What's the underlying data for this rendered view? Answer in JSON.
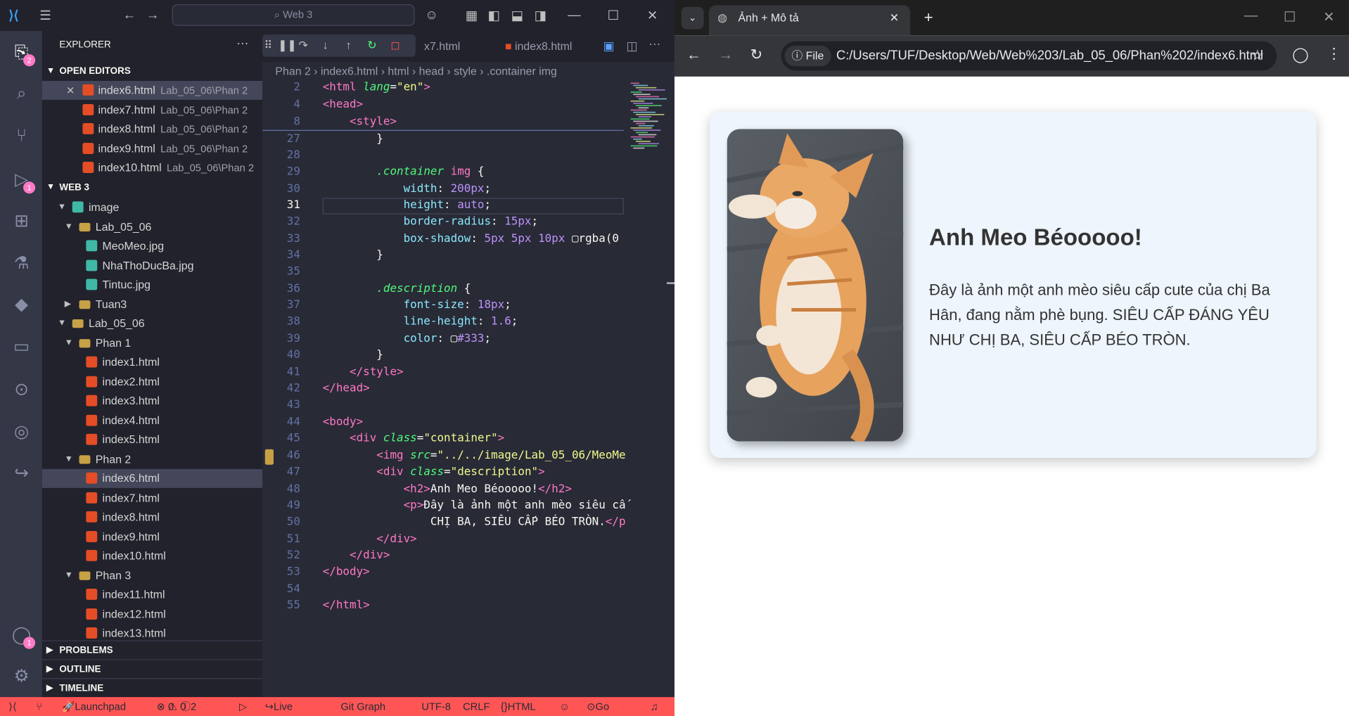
{
  "vscode": {
    "search": "Web 3",
    "sidebar_title": "EXPLORER",
    "open_editors_label": "OPEN EDITORS",
    "open_editors": [
      {
        "name": "index6.html",
        "path": "Lab_05_06\\Phan 2"
      },
      {
        "name": "index7.html",
        "path": "Lab_05_06\\Phan 2"
      },
      {
        "name": "index8.html",
        "path": "Lab_05_06\\Phan 2"
      },
      {
        "name": "index9.html",
        "path": "Lab_05_06\\Phan 2"
      },
      {
        "name": "index10.html",
        "path": "Lab_05_06\\Phan 2"
      }
    ],
    "workspace_label": "WEB 3",
    "tree": [
      {
        "label": "image",
        "kind": "folder-img"
      },
      {
        "label": "Lab_05_06",
        "kind": "folder"
      },
      {
        "label": "MeoMeo.jpg",
        "kind": "img"
      },
      {
        "label": "NhaThoDucBa.jpg",
        "kind": "img"
      },
      {
        "label": "Tintuc.jpg",
        "kind": "img"
      },
      {
        "label": "Tuan3",
        "kind": "folder"
      },
      {
        "label": "Lab_05_06",
        "kind": "folder"
      },
      {
        "label": "Phan 1",
        "kind": "folder"
      },
      {
        "label": "index1.html",
        "kind": "html"
      },
      {
        "label": "index2.html",
        "kind": "html"
      },
      {
        "label": "index3.html",
        "kind": "html"
      },
      {
        "label": "index4.html",
        "kind": "html"
      },
      {
        "label": "index5.html",
        "kind": "html"
      },
      {
        "label": "Phan 2",
        "kind": "folder"
      },
      {
        "label": "index6.html",
        "kind": "html"
      },
      {
        "label": "index7.html",
        "kind": "html"
      },
      {
        "label": "index8.html",
        "kind": "html"
      },
      {
        "label": "index9.html",
        "kind": "html"
      },
      {
        "label": "index10.html",
        "kind": "html"
      },
      {
        "label": "Phan 3",
        "kind": "folder"
      },
      {
        "label": "index11.html",
        "kind": "html"
      },
      {
        "label": "index12.html",
        "kind": "html"
      },
      {
        "label": "index13.html",
        "kind": "html"
      }
    ],
    "panels": [
      "PROBLEMS",
      "OUTLINE",
      "TIMELINE"
    ],
    "tabs": [
      "x7.html",
      "index8.html"
    ],
    "breadcrumb": [
      "Phan 2",
      "index6.html",
      "html",
      "head",
      "style",
      ".container img"
    ],
    "line_numbers": [
      "2",
      "4",
      "8",
      "27",
      "28",
      "29",
      "30",
      "31",
      "32",
      "33",
      "34",
      "35",
      "36",
      "37",
      "38",
      "39",
      "40",
      "41",
      "42",
      "43",
      "44",
      "45",
      "46",
      "47",
      "48",
      "49",
      "50",
      "51",
      "52",
      "53",
      "54",
      "55"
    ],
    "status": {
      "launchpad": "Launchpad",
      "errors": "0",
      "warnings": "0",
      "info": "2",
      "live_share": "Live Share",
      "git_graph": "Git Graph",
      "encoding": "UTF-8",
      "eol": "CRLF",
      "language": "HTML",
      "go_live": "Go Live"
    },
    "accent_color": "#ff5555"
  },
  "browser": {
    "tab_title": "Ảnh + Mô tả",
    "site_chip": "File",
    "url": "C:/Users/TUF/Desktop/Web/Web%203/Lab_05_06/Phan%202/index6.html",
    "card_title": "Anh Meo Béooooo!",
    "card_text": "Đây là ảnh một anh mèo siêu cấp cute của chị Ba Hân, đang nằm phè bụng. SIÊU CẤP ĐÁNG YÊU NHƯ CHỊ BA, SIÊU CẤP BÉO TRÒN."
  }
}
